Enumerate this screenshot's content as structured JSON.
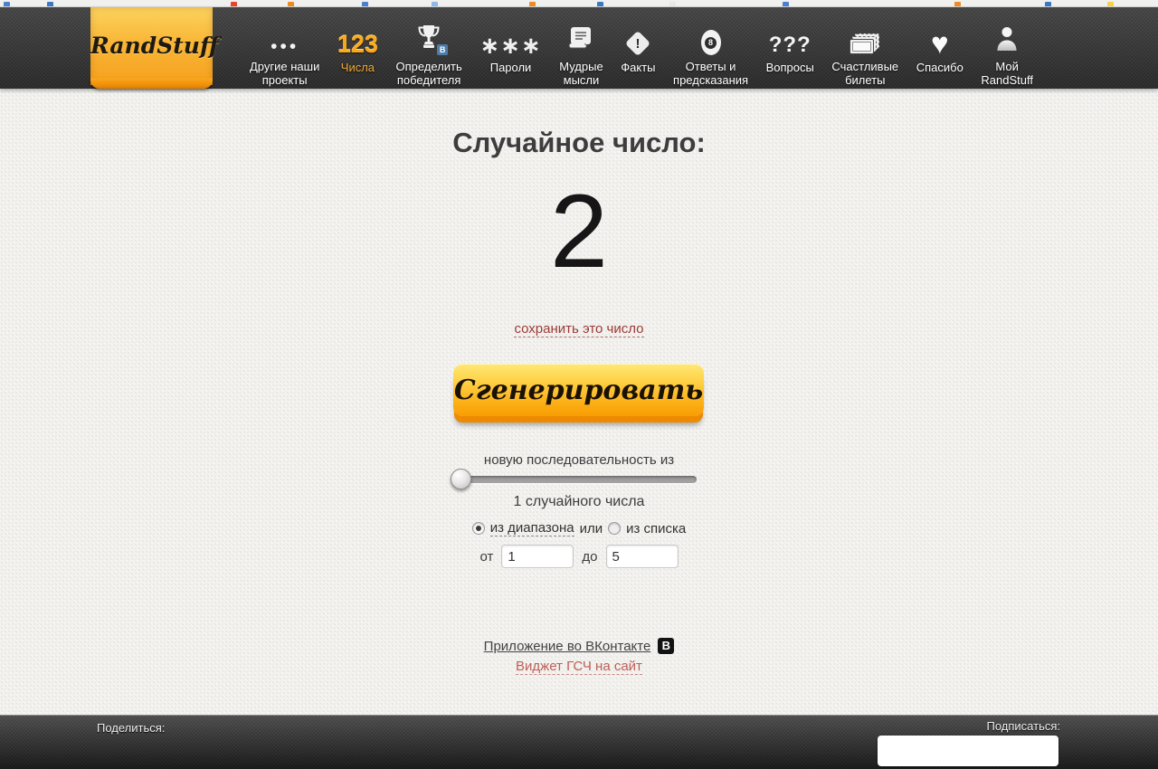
{
  "browser": {
    "favicon_colors": [
      "#4a7fd4",
      "#3a78c3",
      "#e8442e",
      "#f08a24",
      "#4a7fd4",
      "#8fb8e8",
      "#f08a24",
      "#3a78c3",
      "#e8e8e8",
      "#4a7fd4",
      "#f08a24",
      "#3a78c3",
      "#f5d24a"
    ]
  },
  "nav": {
    "logo": "RandStuff",
    "items": [
      {
        "label": "Другие наши\nпроекты",
        "icon": "dots-icon",
        "glyph": "•••",
        "active": false
      },
      {
        "label": "Числа",
        "icon": "numbers-123-icon",
        "glyph": "123",
        "active": true
      },
      {
        "label": "Определить\nпобедителя",
        "icon": "trophy-vk-icon",
        "badge": "B",
        "active": false
      },
      {
        "label": "Пароли",
        "icon": "asterisks-icon",
        "glyph": "∗∗∗",
        "active": false
      },
      {
        "label": "Мудрые\nмысли",
        "icon": "scroll-icon",
        "active": false
      },
      {
        "label": "Факты",
        "icon": "diamond-exclamation-icon",
        "glyph": "!",
        "active": false
      },
      {
        "label": "Ответы и\nпредсказания",
        "icon": "magic-8ball-icon",
        "glyph": "8",
        "active": false
      },
      {
        "label": "Вопросы",
        "icon": "question-marks-icon",
        "glyph": "???",
        "active": false
      },
      {
        "label": "Счастливые\nбилеты",
        "icon": "tickets-icon",
        "active": false
      },
      {
        "label": "Спасибо",
        "icon": "heart-icon",
        "glyph": "♥",
        "active": false
      },
      {
        "label": "Мой\nRandStuff",
        "icon": "user-icon",
        "active": false
      }
    ]
  },
  "main": {
    "title": "Случайное число:",
    "number": "2",
    "save_link": "сохранить это число",
    "generate_button": "Сгенерировать",
    "sequence_prefix": "новую последовательность из",
    "sequence_count": "1 случайного числа",
    "slider": {
      "position": "min",
      "value": 1
    },
    "mode": {
      "range_label": "из диапазона",
      "or_label": "или",
      "list_label": "из списка",
      "selected": "range"
    },
    "range": {
      "from_label": "от",
      "from_value": "1",
      "to_label": "до",
      "to_value": "5"
    }
  },
  "footer_links": {
    "vk_app": "Приложение во ВКонтакте",
    "vk_badge": "B",
    "widget": "Виджет ГСЧ на сайт"
  },
  "footer_bar": {
    "share": "Поделиться:",
    "subscribe": "Подписаться:"
  },
  "colors": {
    "ribbon_orange": "#f9b636",
    "button_orange": "#fbab10",
    "button_lip_orange": "#ee8a00",
    "nav_bg": "#343434",
    "active_nav_label": "#f0a832",
    "page_bg": "#f1f0ed",
    "link_dark_red": "#9c3a36",
    "link_light_red": "#bf5f55",
    "vk_blue": "#4e7ca8"
  }
}
